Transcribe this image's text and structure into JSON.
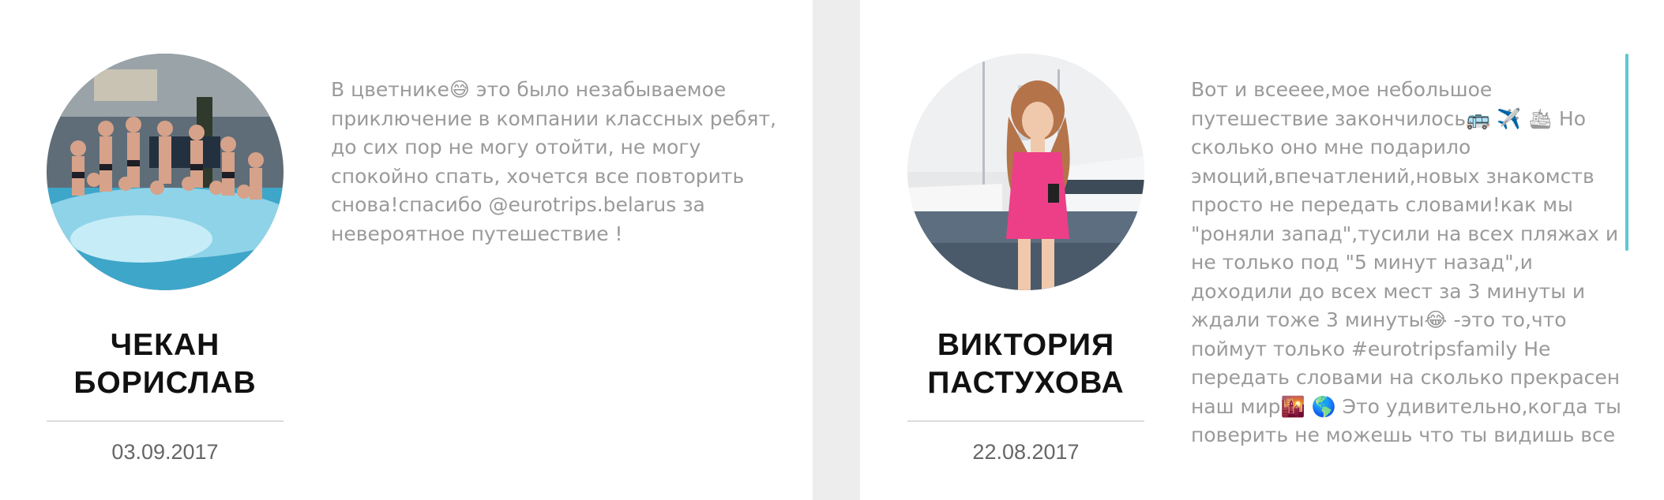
{
  "reviews": [
    {
      "name_line1": "ЧЕКАН",
      "name_line2": "БОРИСЛАВ",
      "date": "03.09.2017",
      "text_lines": [
        "В цветнике😅 это было незабываемое",
        "приключение в компании классных ребят,",
        "до сих пор не могу отойти, не могу",
        "спокойно спать, хочется все повторить",
        "снова!спасибо @eurotrips.belarus за",
        "невероятное путешествие !"
      ]
    },
    {
      "name_line1": "ВИКТОРИЯ",
      "name_line2": "ПАСТУХОВА",
      "date": "22.08.2017",
      "text_lines": [
        "Вот и всееее,мое небольшое",
        "путешествие закончилось🚌 ✈️ 🛳  Но",
        "сколько оно мне подарило",
        "эмоций,впечатлений,новых знакомств",
        "просто не передать словами!как мы",
        "\"роняли запад\",тусили на всех пляжах и",
        "не только под \"5 минут назад\",и",
        "доходили до всех мест за 3 минуты и",
        "ждали тоже 3 минуты😂 -это то,что",
        "поймут только #eurotripsfamily Не",
        "передать словами на сколько прекрасен",
        "наш мир🌇 🌎 Это удивительно,когда ты",
        "поверить не можешь что ты видишь все"
      ]
    }
  ],
  "colors": {
    "page_background": "#ededed",
    "card_background": "#ffffff",
    "name": "#111111",
    "review_text": "#9a9a9a",
    "date": "#666666",
    "scroll_accent": "#5ec8d1"
  }
}
